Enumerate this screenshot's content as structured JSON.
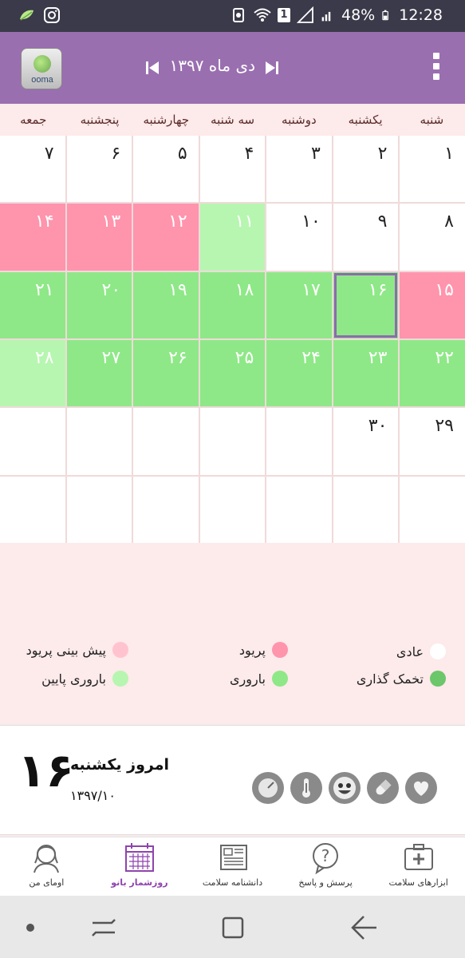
{
  "status_bar": {
    "battery": "48%",
    "time": "12:28",
    "sim_badge": "1"
  },
  "header": {
    "logo_word": "ooma",
    "month_title": "دی ماه ۱۳۹۷"
  },
  "weekdays": [
    "شنبه",
    "یکشنبه",
    "دوشنبه",
    "سه شنبه",
    "چهارشنبه",
    "پنجشنبه",
    "جمعه"
  ],
  "calendar": {
    "cells": [
      {
        "day": "۱",
        "type": "normal"
      },
      {
        "day": "۲",
        "type": "normal"
      },
      {
        "day": "۳",
        "type": "normal"
      },
      {
        "day": "۴",
        "type": "normal"
      },
      {
        "day": "۵",
        "type": "normal"
      },
      {
        "day": "۶",
        "type": "normal"
      },
      {
        "day": "۷",
        "type": "normal"
      },
      {
        "day": "۸",
        "type": "normal"
      },
      {
        "day": "۹",
        "type": "normal"
      },
      {
        "day": "۱۰",
        "type": "normal"
      },
      {
        "day": "۱۱",
        "type": "lowfert"
      },
      {
        "day": "۱۲",
        "type": "period"
      },
      {
        "day": "۱۳",
        "type": "period"
      },
      {
        "day": "۱۴",
        "type": "period"
      },
      {
        "day": "۱۵",
        "type": "period"
      },
      {
        "day": "۱۶",
        "type": "fertile",
        "today": true
      },
      {
        "day": "۱۷",
        "type": "fertile"
      },
      {
        "day": "۱۸",
        "type": "fertile"
      },
      {
        "day": "۱۹",
        "type": "fertile"
      },
      {
        "day": "۲۰",
        "type": "fertile"
      },
      {
        "day": "۲۱",
        "type": "fertile"
      },
      {
        "day": "۲۲",
        "type": "fertile"
      },
      {
        "day": "۲۳",
        "type": "fertile"
      },
      {
        "day": "۲۴",
        "type": "fertile"
      },
      {
        "day": "۲۵",
        "type": "fertile"
      },
      {
        "day": "۲۶",
        "type": "fertile"
      },
      {
        "day": "۲۷",
        "type": "fertile"
      },
      {
        "day": "۲۸",
        "type": "lowfert"
      },
      {
        "day": "۲۹",
        "type": "normal"
      },
      {
        "day": "۳۰",
        "type": "normal"
      },
      {
        "day": "",
        "type": "normal"
      },
      {
        "day": "",
        "type": "normal"
      },
      {
        "day": "",
        "type": "normal"
      },
      {
        "day": "",
        "type": "normal"
      },
      {
        "day": "",
        "type": "normal"
      },
      {
        "day": "",
        "type": "normal"
      },
      {
        "day": "",
        "type": "normal"
      },
      {
        "day": "",
        "type": "normal"
      },
      {
        "day": "",
        "type": "normal"
      },
      {
        "day": "",
        "type": "normal"
      },
      {
        "day": "",
        "type": "normal"
      },
      {
        "day": "",
        "type": "normal"
      }
    ]
  },
  "legend": {
    "normal": "عادی",
    "period": "پریود",
    "predicted_period": "پیش بینی پریود",
    "ovulation": "تخمک گذاری",
    "fertile": "باروری",
    "low_fertile": "باروری پایین",
    "colors": {
      "normal": "#ffffff",
      "period": "#ff94ad",
      "predicted_period": "#ffc3cf",
      "ovulation": "#6cc66a",
      "fertile": "#8ee887",
      "low_fertile": "#b7f6b0"
    }
  },
  "today": {
    "day_number": "۱۶",
    "title": "امروز یکشنبه",
    "date": "۱۳۹۷/۱۰"
  },
  "tools": [
    "heart-icon",
    "pill-icon",
    "smiley-icon",
    "thermometer-icon",
    "scale-icon"
  ],
  "bottom_nav": {
    "items": [
      {
        "label": "ابزارهای سلامت",
        "icon": "medkit-icon"
      },
      {
        "label": "پرسش و پاسخ",
        "icon": "question-bubble-icon"
      },
      {
        "label": "دانشنامه سلامت",
        "icon": "newspaper-icon"
      },
      {
        "label": "روزشمار بانو",
        "icon": "calendar-icon",
        "active": true
      },
      {
        "label": "اومای من",
        "icon": "woman-profile-icon"
      }
    ]
  }
}
